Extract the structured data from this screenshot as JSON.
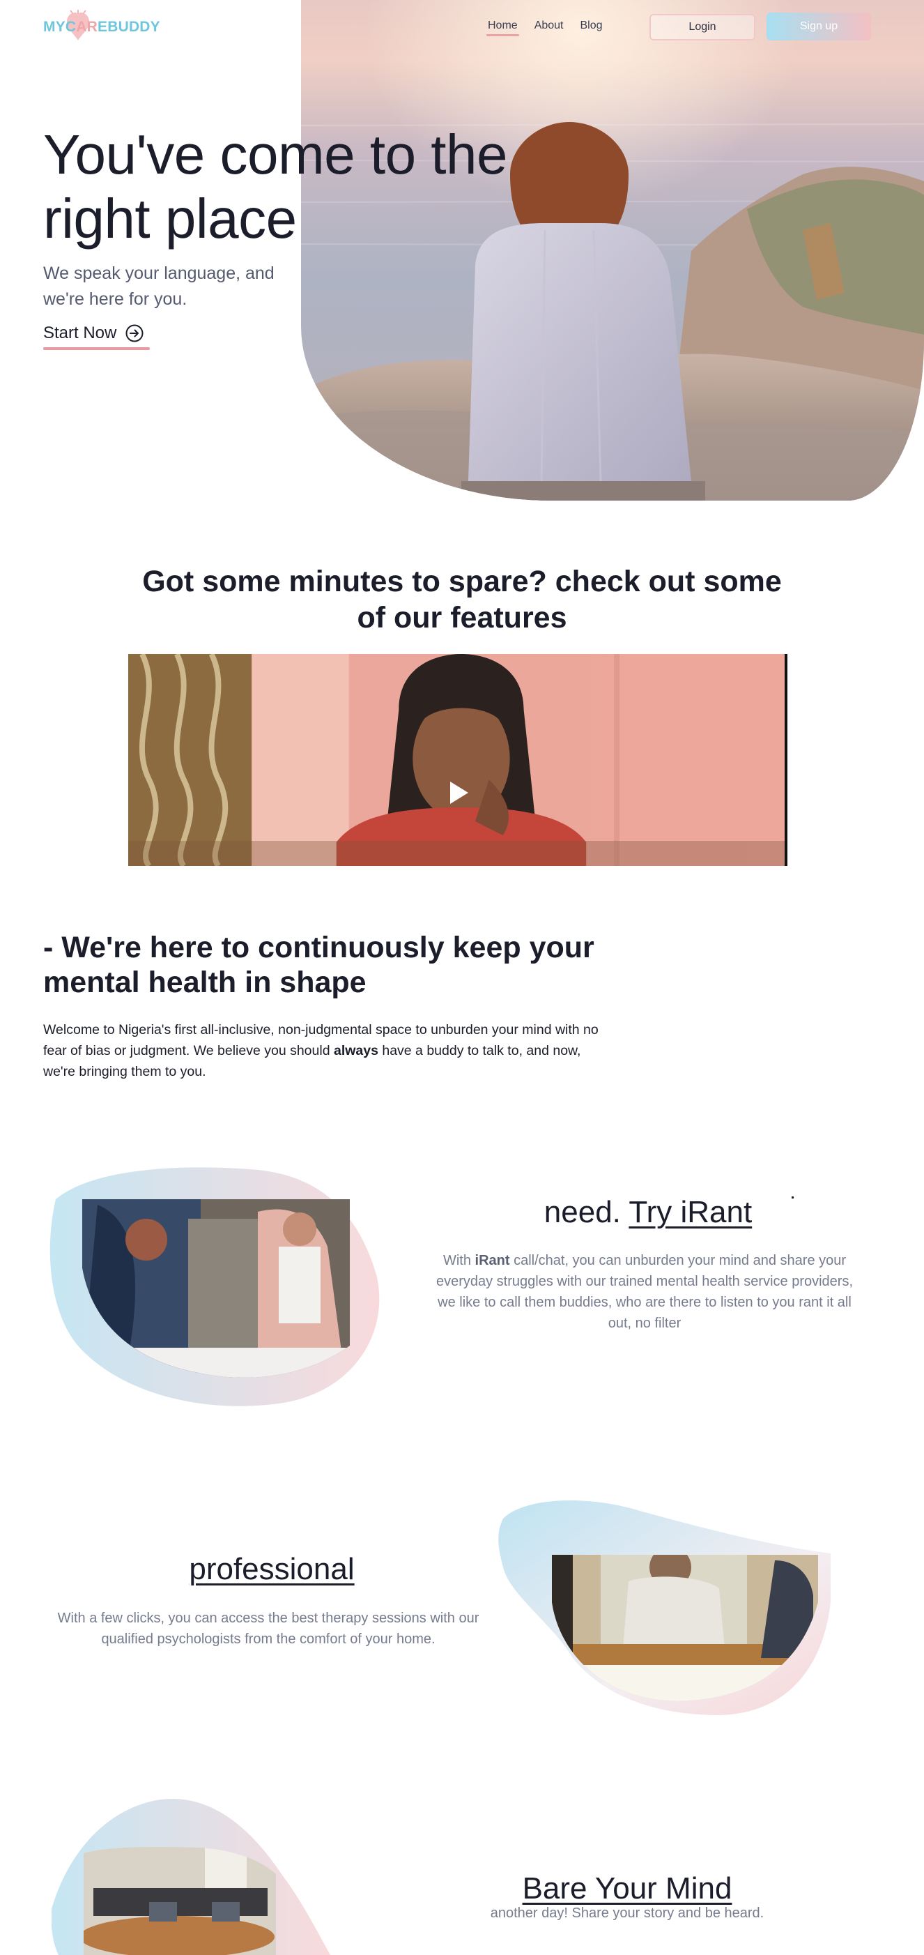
{
  "header": {
    "logo": {
      "part1": "MYC",
      "part2": "AR",
      "part3": "EBUDDY"
    },
    "nav": [
      {
        "label": "Home",
        "active": true
      },
      {
        "label": "About",
        "active": false
      },
      {
        "label": "Blog",
        "active": false
      }
    ],
    "login_label": "Login",
    "signup_label": "Sign up"
  },
  "hero": {
    "title_line1": "You've come to the",
    "title_line2": "right place",
    "subtitle": "We speak your language, and we're here for you.",
    "cta_label": "Start Now"
  },
  "features": {
    "title": "Got some minutes to spare? check out some of our features"
  },
  "about": {
    "title": "- We're here to continuously keep your mental health in shape",
    "text_before": "Welcome to Nigeria's first all-inclusive, non-judgmental space to unburden your mind with no fear of bias or judgment. We believe you should ",
    "text_bold": "always",
    "text_after": " have a buddy to talk to, and now, we're bringing them to you."
  },
  "irant": {
    "heading_prefix": "need. ",
    "heading_link": "Try iRant",
    "text_prefix": "With ",
    "text_bold": "iRant",
    "text_rest": " call/chat, you can unburden your mind and share your everyday struggles with our trained mental health service providers, we like to call them buddies, who are there to listen to you rant it all out, no filter"
  },
  "professional": {
    "heading": "professional",
    "text": "With a few clicks, you can access the best therapy sessions with our qualified psychologists from the comfort of your home."
  },
  "bare_mind": {
    "heading": "Bare Your Mind",
    "text": "another day! Share your story and be heard."
  },
  "colors": {
    "accent_blue": "#6fc6dc",
    "accent_pink": "#e9a2a6",
    "text_dark": "#1b1d2a",
    "text_muted": "#767b8e"
  }
}
